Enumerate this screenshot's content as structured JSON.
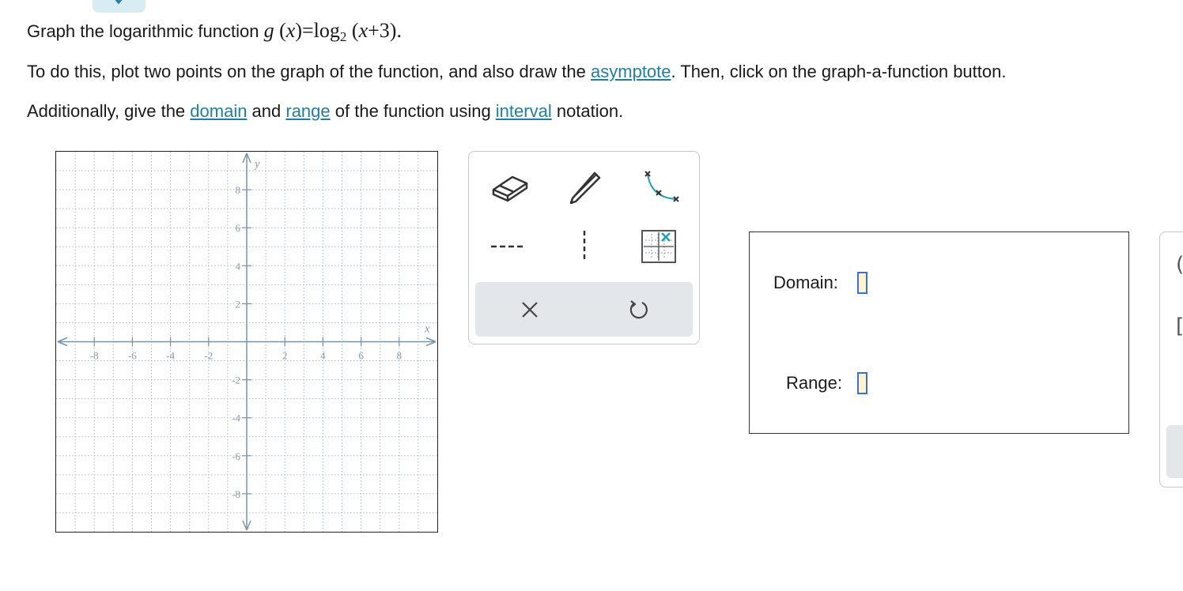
{
  "problem": {
    "line1_text": "Graph the logarithmic function ",
    "func_name": "g",
    "func_var": "x",
    "equals": "=",
    "log": "log",
    "base": "2",
    "arg_var": "x",
    "arg_rest": "+3",
    "period": ".",
    "line2_a": "To do this, plot two points on the graph of the function, and also draw the ",
    "line2_link": "asymptote",
    "line2_b": ". Then, click on the graph-a-function button.",
    "line3_a": "Additionally, give the ",
    "line3_link1": "domain",
    "line3_b": " and ",
    "line3_link2": "range",
    "line3_c": " of the function using ",
    "line3_link3": "interval",
    "line3_d": " notation."
  },
  "graph": {
    "x_axis_label": "x",
    "y_axis_label": "y",
    "xlim": [
      -10,
      10
    ],
    "ylim": [
      -10,
      10
    ],
    "grid": true,
    "x_ticks": [
      -8,
      -6,
      -4,
      -2,
      2,
      4,
      6,
      8
    ],
    "y_ticks": [
      8,
      6,
      4,
      2,
      -2,
      -4,
      -6,
      -8
    ],
    "colors": {
      "axis": "#7a93a6",
      "grid": "#a9b4bd",
      "labels": "#8a9aa6"
    }
  },
  "tools": {
    "items": [
      "eraser-icon",
      "pencil-icon",
      "graph-function-icon",
      "dashed-line-icon",
      "vertical-asymptote-icon",
      "graph-fill-icon"
    ],
    "clear_label": "×",
    "undo_icon": "undo-icon",
    "accent": "#1f9fb5"
  },
  "answers": {
    "domain_label": "Domain:",
    "domain_value": "",
    "range_label": "Range:",
    "range_value": ""
  },
  "side_panel": {
    "glyph1": "(",
    "glyph2": "["
  }
}
